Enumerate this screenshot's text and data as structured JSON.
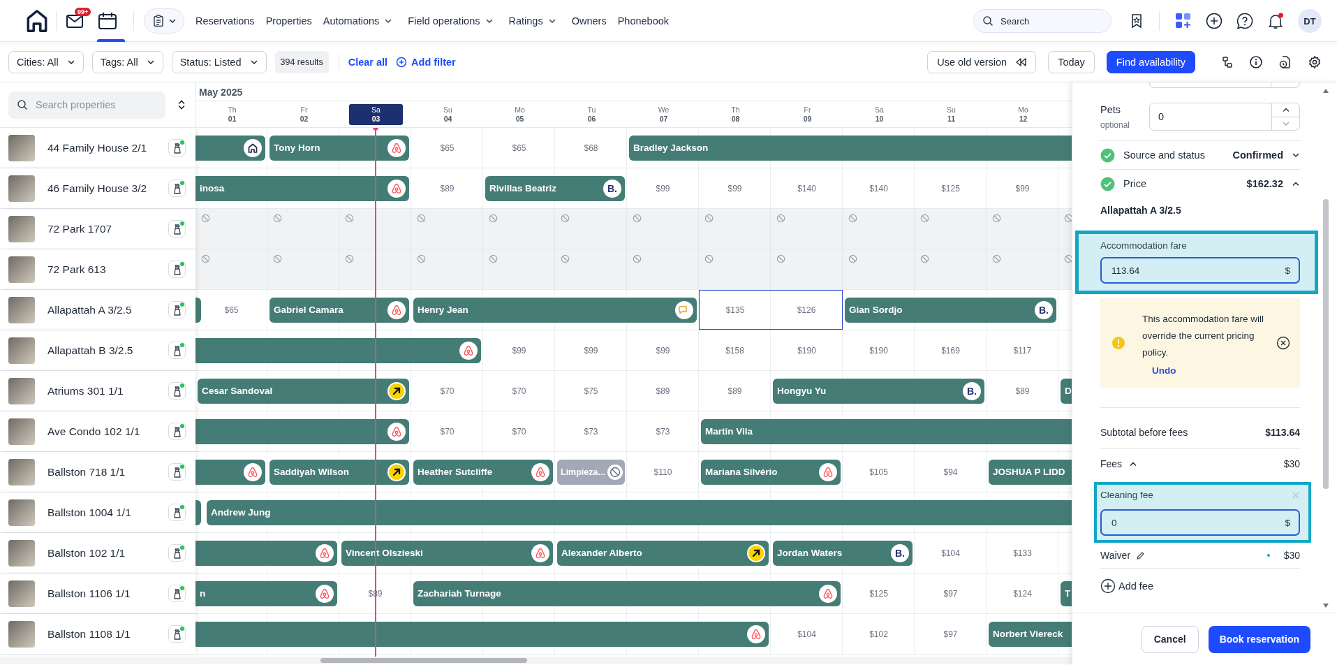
{
  "topbar": {
    "nav_tabs": [
      {
        "kind": "mail",
        "badge": "99+",
        "selected": false
      },
      {
        "kind": "calendar",
        "selected": true
      }
    ],
    "menu": [
      {
        "label": "Reservations",
        "dropdown": false
      },
      {
        "label": "Properties",
        "dropdown": false
      },
      {
        "label": "Automations",
        "dropdown": true
      },
      {
        "label": "Field operations",
        "dropdown": true
      },
      {
        "label": "Ratings",
        "dropdown": true
      },
      {
        "label": "Owners",
        "dropdown": false
      },
      {
        "label": "Phonebook",
        "dropdown": false
      }
    ],
    "search": {
      "placeholder": "Search"
    },
    "notifications_unread": true,
    "avatar": "DT"
  },
  "filters": {
    "chips": [
      "Cities: All",
      "Tags: All",
      "Status: Listed"
    ],
    "results": "394 results",
    "clear": "Clear all",
    "add": "Add filter",
    "old_version": "Use old version",
    "today": "Today",
    "find": "Find availability"
  },
  "calendar": {
    "search": {
      "placeholder": "Search properties"
    },
    "month": "May 2025",
    "days": [
      {
        "weekday": "Th",
        "date": "01",
        "selected": false
      },
      {
        "weekday": "Fr",
        "date": "02",
        "selected": false
      },
      {
        "weekday": "Sa",
        "date": "03",
        "selected": true
      },
      {
        "weekday": "Su",
        "date": "04",
        "selected": false
      },
      {
        "weekday": "Mo",
        "date": "05",
        "selected": false
      },
      {
        "weekday": "Tu",
        "date": "06",
        "selected": false
      },
      {
        "weekday": "We",
        "date": "07",
        "selected": false
      },
      {
        "weekday": "Th",
        "date": "08",
        "selected": false
      },
      {
        "weekday": "Fr",
        "date": "09",
        "selected": false
      },
      {
        "weekday": "Sa",
        "date": "10",
        "selected": false
      },
      {
        "weekday": "Su",
        "date": "11",
        "selected": false
      },
      {
        "weekday": "Mo",
        "date": "12",
        "selected": false
      }
    ],
    "properties": [
      {
        "name": "44 Family House 2/1",
        "cells": [
          {
            "kind": "booking",
            "source": {
              "kind": "home"
            },
            "cut_start": true,
            "cut_end": false
          },
          {
            "kind": "booking",
            "guest": "Tony Horn",
            "source": {
              "kind": "loop"
            },
            "cut_start": false,
            "cut_end": false
          },
          {
            "kind": "stay"
          },
          {
            "kind": "price",
            "text": "$65",
            "selected": false
          },
          {
            "kind": "price",
            "text": "$65",
            "selected": false
          },
          {
            "kind": "price",
            "text": "$68",
            "selected": false
          },
          {
            "kind": "booking",
            "guest": "Bradley Jackson",
            "cut_start": false,
            "cut_end": true
          },
          {
            "kind": "stay"
          },
          {
            "kind": "stay"
          },
          {
            "kind": "stay"
          },
          {
            "kind": "stay"
          },
          {
            "kind": "stay"
          },
          {
            "kind": "stay"
          }
        ]
      },
      {
        "name": "46 Family House 3/2",
        "cells": [
          {
            "kind": "booking",
            "guest": "inosa",
            "source": {
              "kind": "loop"
            },
            "cut_start": true,
            "cut_end": false
          },
          {
            "kind": "stay"
          },
          {
            "kind": "stay"
          },
          {
            "kind": "price",
            "text": "$89",
            "selected": false
          },
          {
            "kind": "booking",
            "guest": "Rivillas Beatriz",
            "source": {
              "kind": "letter",
              "mark": "B."
            },
            "cut_start": false,
            "cut_end": false
          },
          {
            "kind": "stay"
          },
          {
            "kind": "price",
            "text": "$99",
            "selected": false
          },
          {
            "kind": "price",
            "text": "$99",
            "selected": false
          },
          {
            "kind": "price",
            "text": "$140",
            "selected": false
          },
          {
            "kind": "price",
            "text": "$140",
            "selected": false
          },
          {
            "kind": "price",
            "text": "$125",
            "selected": false
          },
          {
            "kind": "price",
            "text": "$99",
            "selected": false
          }
        ]
      },
      {
        "name": "72 Park 1707",
        "cells": [
          {
            "kind": "blocked"
          },
          {
            "kind": "blocked"
          },
          {
            "kind": "blocked"
          },
          {
            "kind": "blocked"
          },
          {
            "kind": "blocked"
          },
          {
            "kind": "blocked"
          },
          {
            "kind": "blocked"
          },
          {
            "kind": "blocked"
          },
          {
            "kind": "blocked"
          },
          {
            "kind": "blocked"
          },
          {
            "kind": "blocked"
          },
          {
            "kind": "blocked"
          },
          {
            "kind": "blocked"
          }
        ]
      },
      {
        "name": "72 Park 613",
        "cells": [
          {
            "kind": "blocked"
          },
          {
            "kind": "blocked"
          },
          {
            "kind": "blocked"
          },
          {
            "kind": "blocked"
          },
          {
            "kind": "blocked"
          },
          {
            "kind": "blocked"
          },
          {
            "kind": "blocked"
          },
          {
            "kind": "blocked"
          },
          {
            "kind": "blocked"
          },
          {
            "kind": "blocked"
          },
          {
            "kind": "blocked"
          },
          {
            "kind": "blocked"
          },
          {
            "kind": "blocked"
          }
        ]
      },
      {
        "name": "Allapattah A 3/2.5",
        "cells": [
          {
            "kind": "stub"
          },
          {
            "kind": "price",
            "text": "$65",
            "selected": false
          },
          {
            "kind": "booking",
            "guest": "Gabriel Camara",
            "source": {
              "kind": "loop"
            },
            "cut_start": false,
            "cut_end": false
          },
          {
            "kind": "stay"
          },
          {
            "kind": "booking",
            "guest": "Henry Jean",
            "source": {
              "kind": "chat"
            },
            "cut_start": false,
            "cut_end": false
          },
          {
            "kind": "stay"
          },
          {
            "kind": "stay"
          },
          {
            "kind": "stay"
          },
          {
            "kind": "price",
            "text": "$135",
            "selected": true
          },
          {
            "kind": "price",
            "text": "$126",
            "selected": true
          },
          {
            "kind": "booking",
            "guest": "Gian Sordjo",
            "source": {
              "kind": "letter",
              "mark": "B."
            },
            "cut_start": false,
            "cut_end": false
          },
          {
            "kind": "stay"
          },
          {
            "kind": "stay"
          }
        ]
      },
      {
        "name": "Allapattah B 3/2.5",
        "cells": [
          {
            "kind": "booking",
            "source": {
              "kind": "loop"
            },
            "cut_start": true,
            "cut_end": false
          },
          {
            "kind": "stay"
          },
          {
            "kind": "stay"
          },
          {
            "kind": "stay"
          },
          {
            "kind": "price",
            "text": "$99",
            "selected": false
          },
          {
            "kind": "price",
            "text": "$99",
            "selected": false
          },
          {
            "kind": "price",
            "text": "$99",
            "selected": false
          },
          {
            "kind": "price",
            "text": "$158",
            "selected": false
          },
          {
            "kind": "price",
            "text": "$190",
            "selected": false
          },
          {
            "kind": "price",
            "text": "$190",
            "selected": false
          },
          {
            "kind": "price",
            "text": "$169",
            "selected": false
          },
          {
            "kind": "price",
            "text": "$117",
            "selected": false
          }
        ]
      },
      {
        "name": "Atriums 301 1/1",
        "cells": [
          {
            "kind": "booking",
            "guest": "Cesar Sandoval",
            "source": {
              "kind": "arrow"
            },
            "cut_start": false,
            "cut_end": false
          },
          {
            "kind": "stay"
          },
          {
            "kind": "stay"
          },
          {
            "kind": "price",
            "text": "$70",
            "selected": false
          },
          {
            "kind": "price",
            "text": "$70",
            "selected": false
          },
          {
            "kind": "price",
            "text": "$75",
            "selected": false
          },
          {
            "kind": "price",
            "text": "$89",
            "selected": false
          },
          {
            "kind": "price",
            "text": "$89",
            "selected": false
          },
          {
            "kind": "booking",
            "guest": "Hongyu Yu",
            "source": {
              "kind": "letter",
              "mark": "B."
            },
            "cut_start": false,
            "cut_end": false
          },
          {
            "kind": "stay"
          },
          {
            "kind": "stay"
          },
          {
            "kind": "price",
            "text": "$89",
            "selected": false
          },
          {
            "kind": "booking",
            "guest": "D",
            "cut_start": false,
            "cut_end": true
          }
        ]
      },
      {
        "name": "Ave Condo 102 1/1",
        "cells": [
          {
            "kind": "booking",
            "source": {
              "kind": "loop"
            },
            "cut_start": true,
            "cut_end": false
          },
          {
            "kind": "stay"
          },
          {
            "kind": "stay"
          },
          {
            "kind": "price",
            "text": "$70",
            "selected": false
          },
          {
            "kind": "price",
            "text": "$70",
            "selected": false
          },
          {
            "kind": "price",
            "text": "$73",
            "selected": false
          },
          {
            "kind": "price",
            "text": "$73",
            "selected": false
          },
          {
            "kind": "booking",
            "guest": "Martin Vila",
            "cut_start": false,
            "cut_end": true
          },
          {
            "kind": "stay"
          },
          {
            "kind": "stay"
          },
          {
            "kind": "stay"
          },
          {
            "kind": "stay"
          },
          {
            "kind": "stay"
          }
        ]
      },
      {
        "name": "Ballston 718 1/1",
        "cells": [
          {
            "kind": "booking",
            "source": {
              "kind": "loop"
            },
            "cut_start": true,
            "cut_end": false
          },
          {
            "kind": "booking",
            "guest": "Saddiyah Wilson",
            "source": {
              "kind": "arrow"
            },
            "cut_start": false,
            "cut_end": false
          },
          {
            "kind": "stay"
          },
          {
            "kind": "booking",
            "guest": "Heather Sutcliffe",
            "source": {
              "kind": "loop"
            },
            "cut_start": false,
            "cut_end": false
          },
          {
            "kind": "stay"
          },
          {
            "kind": "hold",
            "label": "Limpieza..."
          },
          {
            "kind": "price",
            "text": "$110",
            "selected": false
          },
          {
            "kind": "booking",
            "guest": "Mariana Silvério",
            "source": {
              "kind": "loop"
            },
            "cut_start": false,
            "cut_end": false
          },
          {
            "kind": "stay"
          },
          {
            "kind": "price",
            "text": "$105",
            "selected": false
          },
          {
            "kind": "price",
            "text": "$94",
            "selected": false
          },
          {
            "kind": "booking",
            "guest": "JOSHUA P LIDD",
            "cut_start": false,
            "cut_end": true
          },
          {
            "kind": "stay"
          }
        ]
      },
      {
        "name": "Ballston 1004 1/1",
        "cells": [
          {
            "kind": "stub"
          },
          {
            "kind": "booking",
            "guest": "Andrew Jung",
            "cut_start": false,
            "cut_end": true
          },
          {
            "kind": "stay"
          },
          {
            "kind": "stay"
          },
          {
            "kind": "stay"
          },
          {
            "kind": "stay"
          },
          {
            "kind": "stay"
          },
          {
            "kind": "stay"
          },
          {
            "kind": "stay"
          },
          {
            "kind": "stay"
          },
          {
            "kind": "stay"
          },
          {
            "kind": "stay"
          },
          {
            "kind": "stay"
          },
          {
            "kind": "stay"
          }
        ]
      },
      {
        "name": "Ballston 102 1/1",
        "cells": [
          {
            "kind": "booking",
            "source": {
              "kind": "loop"
            },
            "cut_start": true,
            "cut_end": false
          },
          {
            "kind": "stay"
          },
          {
            "kind": "booking",
            "guest": "Vincent Olszieski",
            "source": {
              "kind": "loop"
            },
            "cut_start": false,
            "cut_end": false
          },
          {
            "kind": "stay"
          },
          {
            "kind": "stay"
          },
          {
            "kind": "booking",
            "guest": "Alexander Alberto",
            "source": {
              "kind": "arrow"
            },
            "cut_start": false,
            "cut_end": false
          },
          {
            "kind": "stay"
          },
          {
            "kind": "stay"
          },
          {
            "kind": "booking",
            "guest": "Jordan Waters",
            "source": {
              "kind": "letter",
              "mark": "B."
            },
            "cut_start": false,
            "cut_end": false
          },
          {
            "kind": "stay"
          },
          {
            "kind": "price",
            "text": "$104",
            "selected": false
          },
          {
            "kind": "price",
            "text": "$133",
            "selected": false
          }
        ]
      },
      {
        "name": "Ballston 1106 1/1",
        "cells": [
          {
            "kind": "booking",
            "guest": "n",
            "source": {
              "kind": "loop"
            },
            "cut_start": true,
            "cut_end": false
          },
          {
            "kind": "stay"
          },
          {
            "kind": "price",
            "text": "$89",
            "selected": false
          },
          {
            "kind": "booking",
            "guest": "Zachariah Turnage",
            "source": {
              "kind": "loop"
            },
            "cut_start": false,
            "cut_end": false
          },
          {
            "kind": "stay"
          },
          {
            "kind": "stay"
          },
          {
            "kind": "stay"
          },
          {
            "kind": "stay"
          },
          {
            "kind": "stay"
          },
          {
            "kind": "price",
            "text": "$125",
            "selected": false
          },
          {
            "kind": "price",
            "text": "$97",
            "selected": false
          },
          {
            "kind": "price",
            "text": "$124",
            "selected": false
          },
          {
            "kind": "booking",
            "guest": "T",
            "cut_start": false,
            "cut_end": true
          }
        ]
      },
      {
        "name": "Ballston 1108 1/1",
        "cells": [
          {
            "kind": "booking",
            "source": {
              "kind": "loop"
            },
            "cut_start": true,
            "cut_end": false
          },
          {
            "kind": "stay"
          },
          {
            "kind": "stay"
          },
          {
            "kind": "stay"
          },
          {
            "kind": "stay"
          },
          {
            "kind": "stay"
          },
          {
            "kind": "stay"
          },
          {
            "kind": "stay"
          },
          {
            "kind": "price",
            "text": "$104",
            "selected": false
          },
          {
            "kind": "price",
            "text": "$102",
            "selected": false
          },
          {
            "kind": "price",
            "text": "$97",
            "selected": false
          },
          {
            "kind": "booking",
            "guest": "Norbert Viereck",
            "cut_start": false,
            "cut_end": true
          },
          {
            "kind": "stay"
          }
        ]
      }
    ]
  },
  "panel": {
    "pets": {
      "label": "Pets",
      "hint": "optional",
      "value": "0"
    },
    "sections": [
      {
        "label": "Source and status",
        "value": "Confirmed",
        "complete": true,
        "expanded": false
      },
      {
        "label": "Price",
        "value": "$162.32",
        "complete": true,
        "expanded": true
      }
    ],
    "property": "Allapattah A 3/2.5",
    "fare": {
      "label": "Accommodation fare",
      "value": "113.64",
      "unit": "$",
      "highlighted": true
    },
    "warning": {
      "text": "This accommodation fare will override the current pricing policy.",
      "action": "Undo"
    },
    "subtotal": {
      "label": "Subtotal before fees",
      "value": "$113.64"
    },
    "fees": {
      "label": "Fees",
      "value": "$30",
      "expanded": true,
      "items": [
        {
          "kind": "input",
          "label": "Cleaning fee",
          "value": "0",
          "unit": "$",
          "highlighted": true
        },
        {
          "kind": "line",
          "label": "Waiver",
          "value": "$30"
        }
      ]
    },
    "add_fee": "Add fee",
    "cancel": "Cancel",
    "submit": "Book reservation"
  }
}
